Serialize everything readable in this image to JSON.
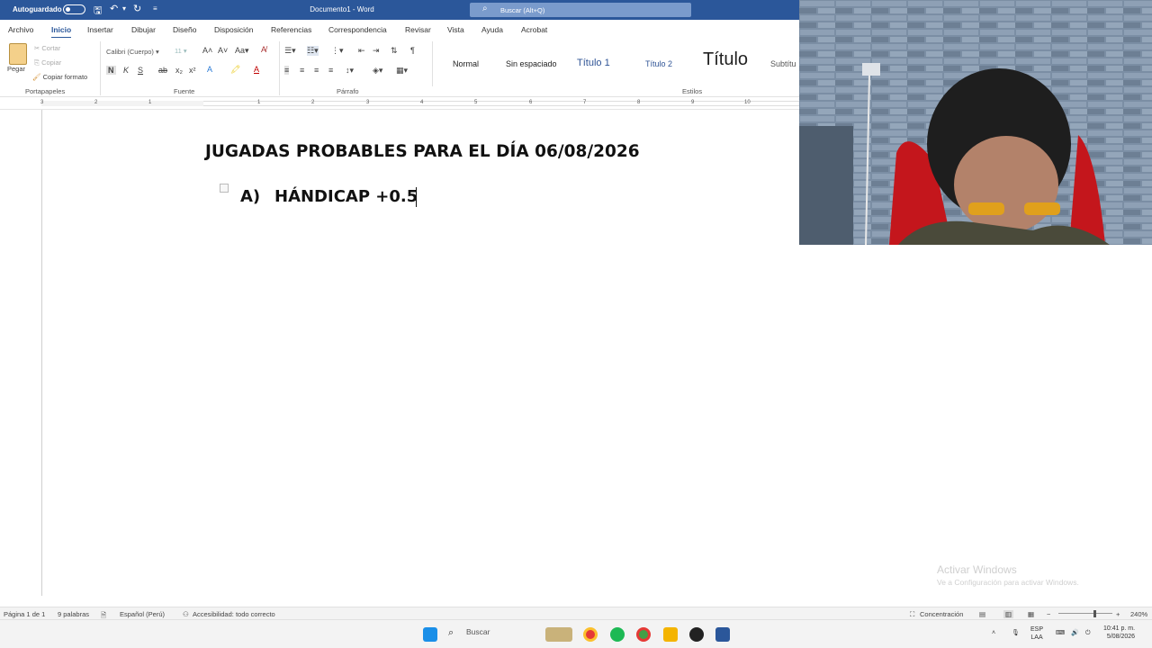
{
  "titlebar": {
    "autosave_label": "Autoguardado",
    "doc_title": "Documento1 - Word",
    "search_placeholder": "Buscar (Alt+Q)"
  },
  "tabs": [
    "Archivo",
    "Inicio",
    "Insertar",
    "Dibujar",
    "Diseño",
    "Disposición",
    "Referencias",
    "Correspondencia",
    "Revisar",
    "Vista",
    "Ayuda",
    "Acrobat"
  ],
  "active_tab": "Inicio",
  "ribbon": {
    "clipboard": {
      "paste": "Pegar",
      "cut": "Cortar",
      "copy": "Copiar",
      "format_painter": "Copiar formato",
      "group_label": "Portapapeles"
    },
    "font": {
      "family": "Calibri (Cuerpo)",
      "size": "11",
      "group_label": "Fuente"
    },
    "paragraph": {
      "group_label": "Párrafo"
    },
    "styles": {
      "items": [
        "Normal",
        "Sin espaciado",
        "Título 1",
        "Título 2",
        "Título",
        "Subtítu"
      ],
      "group_label": "Estilos"
    }
  },
  "ruler_numbers": [
    "3",
    "2",
    "1",
    "1",
    "2",
    "3",
    "4",
    "5",
    "6",
    "7",
    "8",
    "9",
    "10"
  ],
  "document": {
    "heading": "JUGADAS PROBABLES PARA EL DÍA 06/08/2026",
    "list_items": [
      {
        "marker": "A)",
        "text": "HÁNDICAP +0.5"
      }
    ]
  },
  "watermark": {
    "line1": "Activar Windows",
    "line2": "Ve a Configuración para activar Windows."
  },
  "statusbar": {
    "page": "Página 1 de 1",
    "words": "9 palabras",
    "language": "Español (Perú)",
    "accessibility": "Accesibilidad: todo correcto",
    "focus": "Concentración",
    "zoom": "240%"
  },
  "taskbar": {
    "search": "Buscar",
    "lang1": "ESP",
    "lang2": "LAA",
    "time": "10:41 p. m.",
    "date": "5/08/2026"
  }
}
